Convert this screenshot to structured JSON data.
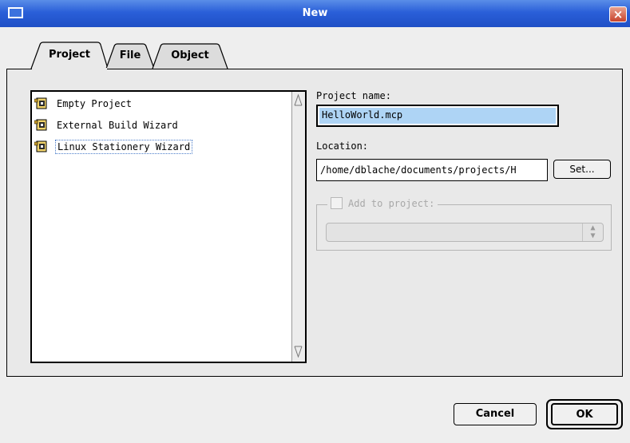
{
  "window": {
    "title": "New",
    "close_glyph": "×"
  },
  "tabs": [
    {
      "label": "Project",
      "active": true
    },
    {
      "label": "File",
      "active": false
    },
    {
      "label": "Object",
      "active": false
    }
  ],
  "project_list": {
    "items": [
      {
        "label": "Empty Project",
        "icon": "project-stationery-icon",
        "selected": false
      },
      {
        "label": "External Build Wizard",
        "icon": "project-stationery-icon",
        "selected": false
      },
      {
        "label": "Linux Stationery Wizard",
        "icon": "project-stationery-icon",
        "selected": true
      }
    ]
  },
  "form": {
    "project_name_label": "Project name:",
    "project_name_value": "HelloWorld.mcp",
    "location_label": "Location:",
    "location_value": "/home/dblache/documents/projects/H",
    "set_button": "Set...",
    "add_to_project_label": "Add to project:",
    "add_to_project_checked": false,
    "add_to_project_enabled": false,
    "add_to_project_select_value": ""
  },
  "buttons": {
    "cancel": "Cancel",
    "ok": "OK"
  },
  "colors": {
    "titlebar": "#2a5fd8",
    "selection_highlight": "#aed4f5",
    "close_button": "#c7432c"
  }
}
